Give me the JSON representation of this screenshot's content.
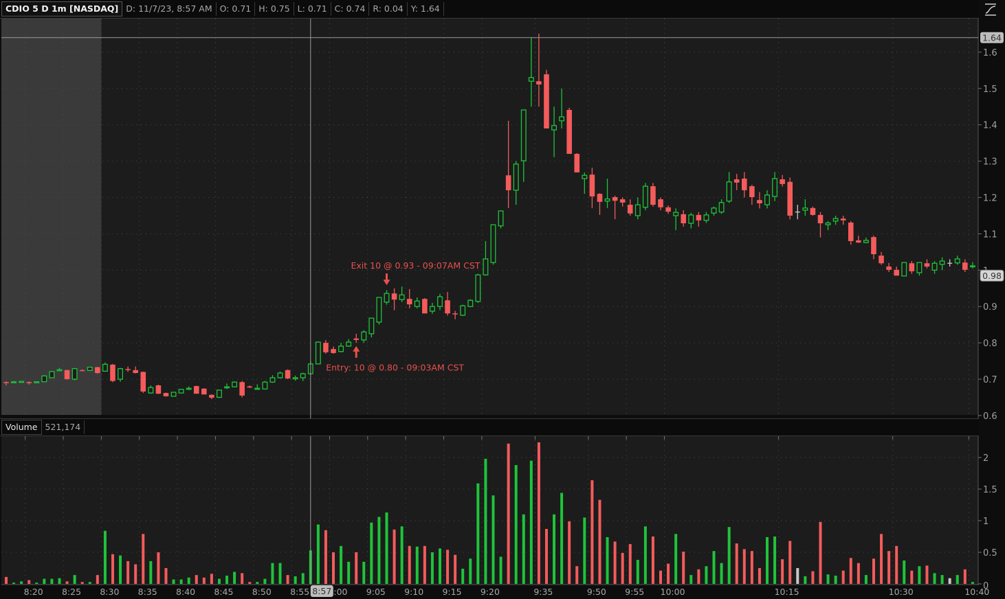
{
  "header": {
    "symbol": "CDIO 5 D 1m [NASDAQ]",
    "date": "D: 11/7/23, 8:57 AM",
    "open": "O: 0.71",
    "high": "H: 0.75",
    "low": "L: 0.71",
    "close": "C: 0.74",
    "range": "R: 0.04",
    "y": "Y: 1.64"
  },
  "volume_header": {
    "label": "Volume",
    "value": "521,174"
  },
  "toolbar": {
    "style_icon": "drawing-style-icon"
  },
  "colors": {
    "up": "#1ec43a",
    "down": "#f45b5b",
    "flat": "#c8c8c8",
    "annotation": "#e8514f",
    "background": "#1c1c1c",
    "premarket": "#3a3a3a"
  },
  "chart_data": {
    "type": "candlestick",
    "title": "CDIO 5 D 1m [NASDAQ]",
    "price_axis": {
      "min": 0.604,
      "max": 1.692,
      "ticks": [
        0.6,
        0.7,
        0.8,
        0.9,
        1.0,
        1.1,
        1.2,
        1.3,
        1.4,
        1.5,
        1.6
      ],
      "tick_labels": [
        "0.6",
        "0.7",
        "0.8",
        "0.9",
        "1",
        "1.1",
        "1.2",
        "1.3",
        "1.4",
        "1.5",
        "1.6"
      ],
      "grid": true
    },
    "volume_axis": {
      "min": 0,
      "max": 2.35,
      "ticks": [
        0,
        0.5,
        1,
        1.5,
        2
      ],
      "tick_labels": [
        "0",
        "0.5",
        "1",
        "1.5",
        "2"
      ],
      "grid": true
    },
    "x_ticks": [
      {
        "label": "8:20",
        "bar": 2.5
      },
      {
        "label": "8:25",
        "bar": 7.5
      },
      {
        "label": "8:30",
        "bar": 12.5
      },
      {
        "label": "8:35",
        "bar": 17.5
      },
      {
        "label": "8:40",
        "bar": 22.5
      },
      {
        "label": "8:45",
        "bar": 27.5
      },
      {
        "label": "8:50",
        "bar": 32.5
      },
      {
        "label": "8:55",
        "bar": 37.5
      },
      {
        "label": "9:00",
        "bar": 42.5
      },
      {
        "label": "9:05",
        "bar": 47.5
      },
      {
        "label": "9:10",
        "bar": 52.5
      },
      {
        "label": "9:15",
        "bar": 57.5
      },
      {
        "label": "9:20",
        "bar": 62.5
      },
      {
        "label": "9:35",
        "bar": 69.5
      },
      {
        "label": "9:50",
        "bar": 76.5
      },
      {
        "label": "9:55",
        "bar": 81.5
      },
      {
        "label": "10:00",
        "bar": 86.5
      },
      {
        "label": "10:15",
        "bar": 101.5
      },
      {
        "label": "10:30",
        "bar": 116.5
      },
      {
        "label": "10:40",
        "bar": 126.5
      }
    ],
    "premarket_end_bar": 12.5,
    "crosshair": {
      "bar": 40,
      "price": 1.64,
      "time_label": "8:57",
      "price_label": "1.64"
    },
    "last_price": {
      "price": 0.985,
      "label": "0.98"
    },
    "annotations": [
      {
        "text": "Exit 10 @ 0.93 - 09:07AM CST",
        "bar": 50,
        "price": 0.955,
        "direction": "down"
      },
      {
        "text": "Entry: 10 @ 0.80 - 09:03AM CST",
        "bar": 46,
        "price": 0.795,
        "direction": "up"
      }
    ],
    "candles": [
      [
        0.692,
        0.694,
        0.683,
        0.691
      ],
      [
        0.691,
        0.695,
        0.689,
        0.693
      ],
      [
        0.692,
        0.695,
        0.691,
        0.694
      ],
      [
        0.692,
        0.694,
        0.685,
        0.691
      ],
      [
        0.691,
        0.694,
        0.69,
        0.693
      ],
      [
        0.693,
        0.711,
        0.692,
        0.709
      ],
      [
        0.704,
        0.722,
        0.703,
        0.721
      ],
      [
        0.725,
        0.731,
        0.724,
        0.726
      ],
      [
        0.725,
        0.726,
        0.699,
        0.7
      ],
      [
        0.7,
        0.731,
        0.697,
        0.729
      ],
      [
        0.725,
        0.727,
        0.722,
        0.723
      ],
      [
        0.724,
        0.734,
        0.723,
        0.733
      ],
      [
        0.733,
        0.734,
        0.715,
        0.717
      ],
      [
        0.722,
        0.746,
        0.721,
        0.741
      ],
      [
        0.74,
        0.742,
        0.692,
        0.695
      ],
      [
        0.7,
        0.731,
        0.693,
        0.729
      ],
      [
        0.728,
        0.735,
        0.72,
        0.726
      ],
      [
        0.725,
        0.735,
        0.716,
        0.717
      ],
      [
        0.72,
        0.721,
        0.662,
        0.666
      ],
      [
        0.662,
        0.683,
        0.66,
        0.677
      ],
      [
        0.683,
        0.685,
        0.659,
        0.66
      ],
      [
        0.662,
        0.663,
        0.652,
        0.653
      ],
      [
        0.653,
        0.665,
        0.652,
        0.664
      ],
      [
        0.662,
        0.673,
        0.661,
        0.672
      ],
      [
        0.674,
        0.68,
        0.67,
        0.675
      ],
      [
        0.681,
        0.682,
        0.66,
        0.66
      ],
      [
        0.674,
        0.675,
        0.658,
        0.658
      ],
      [
        0.657,
        0.658,
        0.645,
        0.649
      ],
      [
        0.65,
        0.67,
        0.648,
        0.67
      ],
      [
        0.677,
        0.688,
        0.673,
        0.679
      ],
      [
        0.679,
        0.694,
        0.678,
        0.692
      ],
      [
        0.692,
        0.695,
        0.65,
        0.655
      ],
      [
        0.68,
        0.683,
        0.676,
        0.677
      ],
      [
        0.674,
        0.686,
        0.671,
        0.675
      ],
      [
        0.673,
        0.695,
        0.672,
        0.692
      ],
      [
        0.692,
        0.711,
        0.69,
        0.704
      ],
      [
        0.704,
        0.721,
        0.702,
        0.717
      ],
      [
        0.725,
        0.727,
        0.7,
        0.702
      ],
      [
        0.701,
        0.71,
        0.696,
        0.704
      ],
      [
        0.704,
        0.718,
        0.695,
        0.715
      ],
      [
        0.715,
        0.75,
        0.712,
        0.742
      ],
      [
        0.742,
        0.804,
        0.741,
        0.802
      ],
      [
        0.8,
        0.808,
        0.77,
        0.774
      ],
      [
        0.783,
        0.79,
        0.77,
        0.772
      ],
      [
        0.776,
        0.8,
        0.774,
        0.791
      ],
      [
        0.791,
        0.81,
        0.789,
        0.802
      ],
      [
        0.812,
        0.825,
        0.8,
        0.808
      ],
      [
        0.808,
        0.835,
        0.8,
        0.83
      ],
      [
        0.825,
        0.868,
        0.815,
        0.868
      ],
      [
        0.857,
        0.925,
        0.85,
        0.925
      ],
      [
        0.912,
        0.945,
        0.905,
        0.936
      ],
      [
        0.936,
        0.95,
        0.89,
        0.919
      ],
      [
        0.919,
        0.955,
        0.912,
        0.932
      ],
      [
        0.921,
        0.948,
        0.895,
        0.906
      ],
      [
        0.9,
        0.925,
        0.895,
        0.915
      ],
      [
        0.921,
        0.923,
        0.881,
        0.881
      ],
      [
        0.887,
        0.91,
        0.88,
        0.9
      ],
      [
        0.9,
        0.935,
        0.89,
        0.927
      ],
      [
        0.917,
        0.94,
        0.875,
        0.881
      ],
      [
        0.881,
        0.888,
        0.865,
        0.879
      ],
      [
        0.876,
        0.905,
        0.874,
        0.902
      ],
      [
        0.9,
        0.92,
        0.898,
        0.917
      ],
      [
        0.914,
        0.99,
        0.91,
        0.987
      ],
      [
        0.987,
        1.08,
        0.985,
        1.031
      ],
      [
        1.021,
        1.125,
        1.015,
        1.125
      ],
      [
        1.122,
        1.163,
        1.115,
        1.163
      ],
      [
        1.261,
        1.411,
        1.171,
        1.22
      ],
      [
        1.22,
        1.3,
        1.18,
        1.292
      ],
      [
        1.301,
        1.441,
        1.243,
        1.441
      ],
      [
        1.52,
        1.641,
        1.45,
        1.53
      ],
      [
        1.52,
        1.651,
        1.45,
        1.511
      ],
      [
        1.539,
        1.551,
        1.39,
        1.39
      ],
      [
        1.386,
        1.45,
        1.311,
        1.398
      ],
      [
        1.411,
        1.5,
        1.39,
        1.422
      ],
      [
        1.441,
        1.447,
        1.32,
        1.32
      ],
      [
        1.32,
        1.322,
        1.269,
        1.269
      ],
      [
        1.252,
        1.269,
        1.21,
        1.261
      ],
      [
        1.263,
        1.282,
        1.171,
        1.203
      ],
      [
        1.21,
        1.212,
        1.152,
        1.188
      ],
      [
        1.19,
        1.252,
        1.171,
        1.196
      ],
      [
        1.201,
        1.205,
        1.14,
        1.191
      ],
      [
        1.195,
        1.2,
        1.175,
        1.186
      ],
      [
        1.18,
        1.195,
        1.15,
        1.156
      ],
      [
        1.15,
        1.2,
        1.14,
        1.18
      ],
      [
        1.173,
        1.24,
        1.165,
        1.231
      ],
      [
        1.231,
        1.24,
        1.175,
        1.18
      ],
      [
        1.195,
        1.2,
        1.165,
        1.173
      ],
      [
        1.173,
        1.178,
        1.155,
        1.161
      ],
      [
        1.15,
        1.17,
        1.11,
        1.159
      ],
      [
        1.154,
        1.165,
        1.12,
        1.129
      ],
      [
        1.129,
        1.158,
        1.115,
        1.152
      ],
      [
        1.152,
        1.16,
        1.12,
        1.137
      ],
      [
        1.137,
        1.16,
        1.13,
        1.152
      ],
      [
        1.157,
        1.175,
        1.15,
        1.171
      ],
      [
        1.16,
        1.195,
        1.155,
        1.186
      ],
      [
        1.19,
        1.27,
        1.185,
        1.243
      ],
      [
        1.25,
        1.265,
        1.22,
        1.241
      ],
      [
        1.252,
        1.27,
        1.2,
        1.22
      ],
      [
        1.231,
        1.235,
        1.18,
        1.201
      ],
      [
        1.193,
        1.215,
        1.17,
        1.184
      ],
      [
        1.18,
        1.22,
        1.17,
        1.207
      ],
      [
        1.203,
        1.27,
        1.19,
        1.252
      ],
      [
        1.25,
        1.262,
        1.23,
        1.237
      ],
      [
        1.243,
        1.255,
        1.14,
        1.15
      ],
      [
        1.16,
        1.18,
        1.14,
        1.16
      ],
      [
        1.165,
        1.195,
        1.15,
        1.171
      ],
      [
        1.171,
        1.175,
        1.15,
        1.152
      ],
      [
        1.152,
        1.16,
        1.09,
        1.129
      ],
      [
        1.125,
        1.135,
        1.11,
        1.13
      ],
      [
        1.135,
        1.15,
        1.125,
        1.142
      ],
      [
        1.142,
        1.15,
        1.125,
        1.137
      ],
      [
        1.131,
        1.135,
        1.07,
        1.08
      ],
      [
        1.082,
        1.095,
        1.075,
        1.076
      ],
      [
        1.076,
        1.09,
        1.074,
        1.082
      ],
      [
        1.091,
        1.095,
        1.03,
        1.044
      ],
      [
        1.04,
        1.05,
        1.015,
        1.019
      ],
      [
        1.01,
        1.02,
        0.995,
        1.001
      ],
      [
        1.001,
        1.01,
        0.985,
        0.985
      ],
      [
        0.984,
        1.021,
        0.983,
        1.021
      ],
      [
        1.019,
        1.025,
        0.99,
        0.997
      ],
      [
        0.993,
        1.022,
        0.985,
        1.021
      ],
      [
        1.019,
        1.03,
        1.005,
        1.01
      ],
      [
        1.0,
        1.025,
        0.99,
        1.019
      ],
      [
        1.016,
        1.035,
        1.0,
        1.025
      ],
      [
        1.019,
        1.03,
        1.01,
        1.019
      ],
      [
        1.02,
        1.04,
        1.015,
        1.031
      ],
      [
        1.021,
        1.03,
        0.995,
        1.001
      ],
      [
        1.01,
        1.022,
        1.005,
        1.012
      ]
    ],
    "volume": [
      0.11,
      0.02,
      0.04,
      0.06,
      0.02,
      0.08,
      0.08,
      0.09,
      0.04,
      0.14,
      0.03,
      0.03,
      0.14,
      0.84,
      0.47,
      0.45,
      0.36,
      0.31,
      0.79,
      0.36,
      0.5,
      0.25,
      0.07,
      0.07,
      0.1,
      0.14,
      0.1,
      0.16,
      0.08,
      0.13,
      0.19,
      0.17,
      0.03,
      0.03,
      0.08,
      0.33,
      0.33,
      0.14,
      0.12,
      0.17,
      0.53,
      0.94,
      0.85,
      0.5,
      0.6,
      0.35,
      0.5,
      0.35,
      0.97,
      1.06,
      1.13,
      0.86,
      0.91,
      0.6,
      0.59,
      0.6,
      0.5,
      0.56,
      0.54,
      0.46,
      0.24,
      0.4,
      1.59,
      1.98,
      1.4,
      0.43,
      2.22,
      1.88,
      1.1,
      1.95,
      2.24,
      0.87,
      1.1,
      1.44,
      0.99,
      0.28,
      1.05,
      1.64,
      1.33,
      0.74,
      0.67,
      0.49,
      0.63,
      0.38,
      0.91,
      0.75,
      0.21,
      0.32,
      0.79,
      0.51,
      0.14,
      0.23,
      0.28,
      0.52,
      0.33,
      0.9,
      0.64,
      0.55,
      0.52,
      0.25,
      0.74,
      0.75,
      0.39,
      0.68,
      0.25,
      0.12,
      0.2,
      0.98,
      0.15,
      0.13,
      0.21,
      0.41,
      0.33,
      0.14,
      0.4,
      0.79,
      0.52,
      0.6,
      0.37,
      0.21,
      0.28,
      0.29,
      0.17,
      0.14,
      0.09,
      0.14,
      0.23,
      0.03
    ]
  }
}
